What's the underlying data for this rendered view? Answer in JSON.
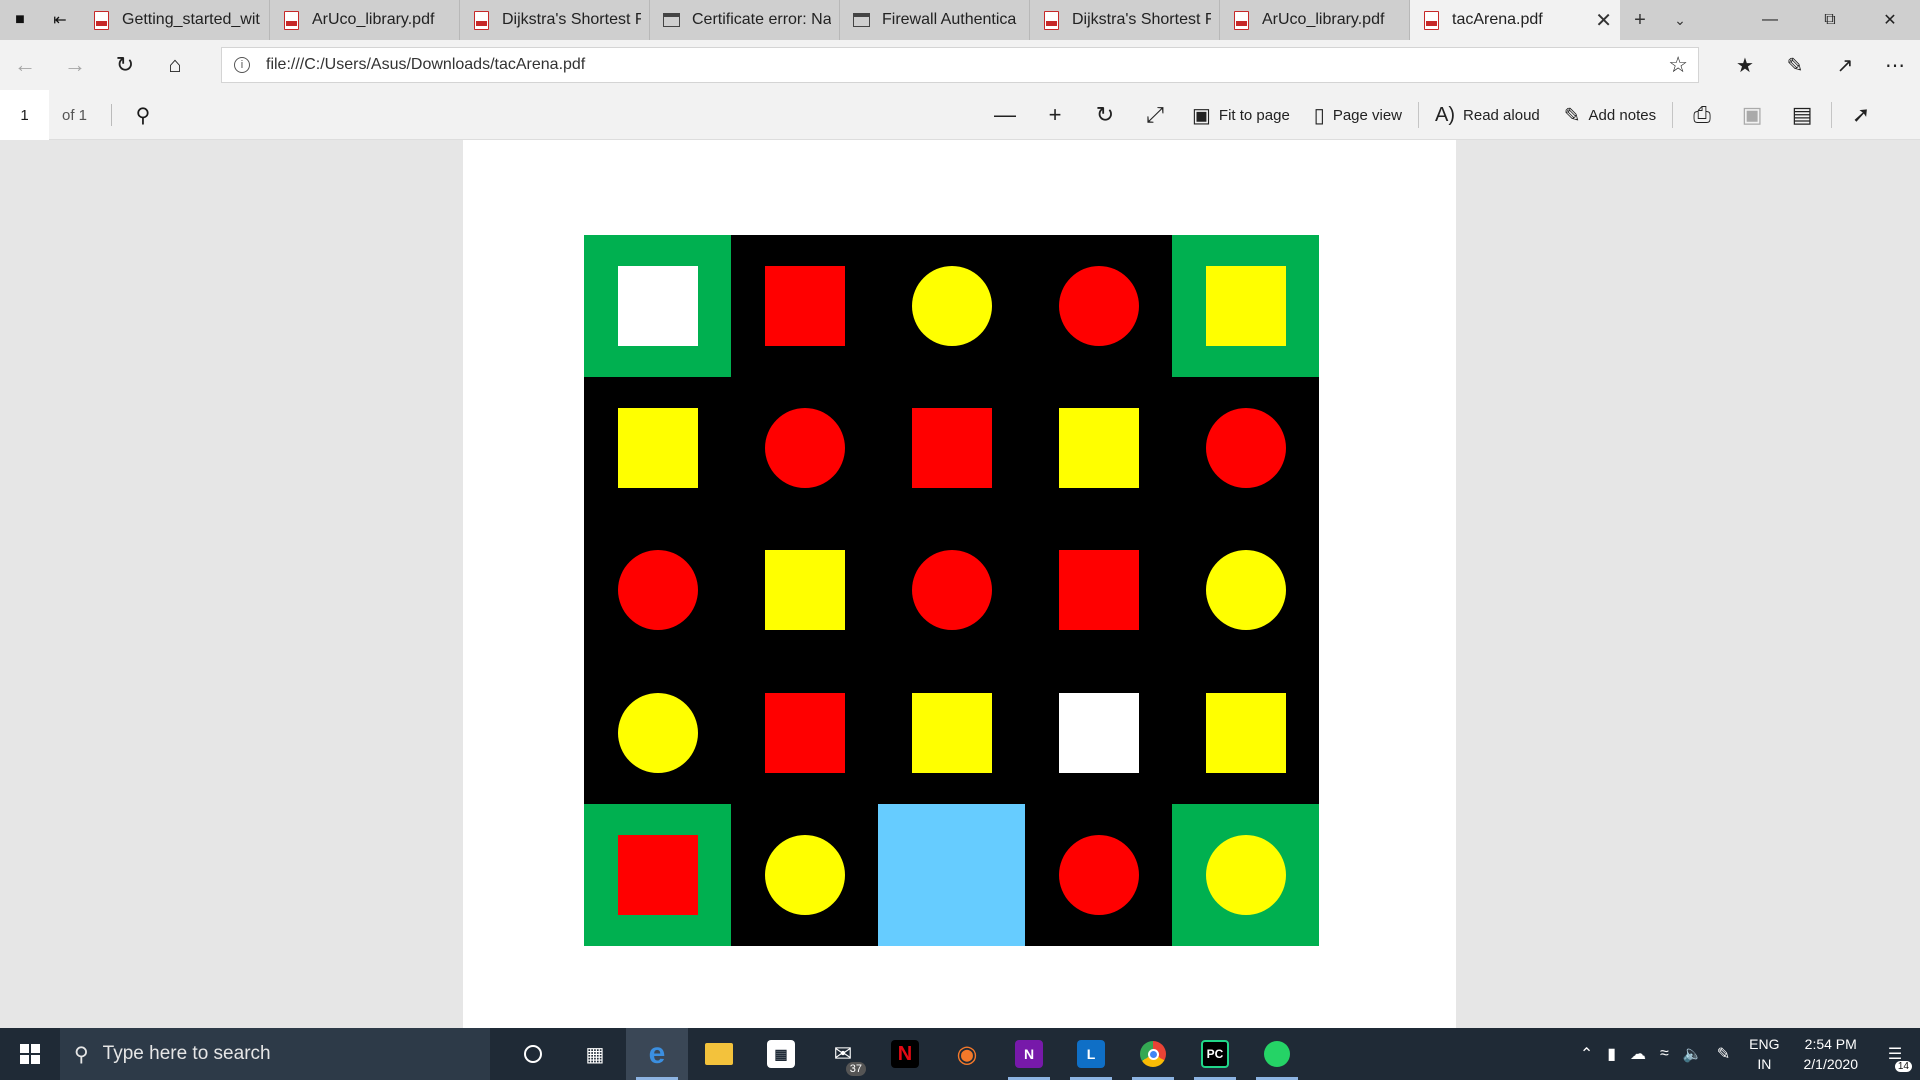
{
  "browser": {
    "tabs": [
      {
        "label": "Getting_started_wit",
        "icon": "pdf-icon"
      },
      {
        "label": "ArUco_library.pdf",
        "icon": "pdf-icon"
      },
      {
        "label": "Dijkstra's Shortest F",
        "icon": "pdf-icon"
      },
      {
        "label": "Certificate error: Na",
        "icon": "page-icon"
      },
      {
        "label": "Firewall Authentica",
        "icon": "page-icon"
      },
      {
        "label": "Dijkstra's Shortest F",
        "icon": "pdf-icon"
      },
      {
        "label": "ArUco_library.pdf",
        "icon": "pdf-icon"
      },
      {
        "label": "tacArena.pdf",
        "icon": "pdf-icon",
        "active": true
      }
    ],
    "url": "file:///C:/Users/Asus/Downloads/tacArena.pdf"
  },
  "pdf_toolbar": {
    "page_number": "1",
    "page_of": "of 1",
    "fit_to_page": "Fit to page",
    "page_view": "Page view",
    "read_aloud": "Read aloud",
    "add_notes": "Add notes"
  },
  "arena": {
    "colors": {
      "black": "#000000",
      "green": "#00b050",
      "red": "#ff0000",
      "yellow": "#ffff00",
      "white": "#ffffff",
      "blue": "#66ccff"
    },
    "grid": [
      [
        {
          "bg": "green",
          "shape": "square",
          "color": "white"
        },
        {
          "bg": "black",
          "shape": "square",
          "color": "red"
        },
        {
          "bg": "black",
          "shape": "circle",
          "color": "yellow"
        },
        {
          "bg": "black",
          "shape": "circle",
          "color": "red"
        },
        {
          "bg": "green",
          "shape": "square",
          "color": "yellow"
        }
      ],
      [
        {
          "bg": "black",
          "shape": "square",
          "color": "yellow"
        },
        {
          "bg": "black",
          "shape": "circle",
          "color": "red"
        },
        {
          "bg": "black",
          "shape": "square",
          "color": "red"
        },
        {
          "bg": "black",
          "shape": "square",
          "color": "yellow"
        },
        {
          "bg": "black",
          "shape": "circle",
          "color": "red"
        }
      ],
      [
        {
          "bg": "black",
          "shape": "circle",
          "color": "red"
        },
        {
          "bg": "black",
          "shape": "square",
          "color": "yellow"
        },
        {
          "bg": "black",
          "shape": "circle",
          "color": "red"
        },
        {
          "bg": "black",
          "shape": "square",
          "color": "red"
        },
        {
          "bg": "black",
          "shape": "circle",
          "color": "yellow"
        }
      ],
      [
        {
          "bg": "black",
          "shape": "circle",
          "color": "yellow"
        },
        {
          "bg": "black",
          "shape": "square",
          "color": "red"
        },
        {
          "bg": "black",
          "shape": "square",
          "color": "yellow"
        },
        {
          "bg": "black",
          "shape": "square",
          "color": "white"
        },
        {
          "bg": "black",
          "shape": "square",
          "color": "yellow"
        }
      ],
      [
        {
          "bg": "green",
          "shape": "square",
          "color": "red"
        },
        {
          "bg": "black",
          "shape": "circle",
          "color": "yellow"
        },
        {
          "bg": "blue",
          "shape": "none",
          "color": "blue"
        },
        {
          "bg": "black",
          "shape": "circle",
          "color": "red"
        },
        {
          "bg": "green",
          "shape": "circle",
          "color": "yellow"
        }
      ]
    ]
  },
  "taskbar": {
    "search_placeholder": "Type here to search",
    "mail_badge": "37",
    "lang": "ENG",
    "region": "IN",
    "time": "2:54 PM",
    "date": "2/1/2020",
    "notifications": "14"
  }
}
